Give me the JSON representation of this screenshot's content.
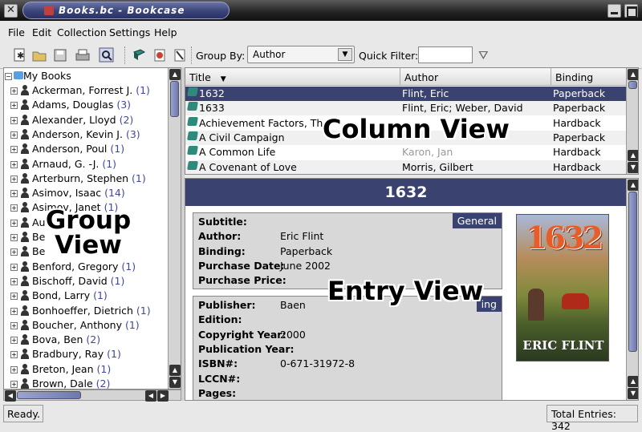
{
  "window": {
    "title": "Books.bc - Bookcase"
  },
  "menu": [
    "File",
    "Edit",
    "Collection",
    "Settings",
    "Help"
  ],
  "toolbar": {
    "group_by_label": "Group By:",
    "group_by_value": "Author",
    "quick_filter_label": "Quick Filter:",
    "quick_filter_value": ""
  },
  "group_view": {
    "root": "My Books",
    "items": [
      {
        "name": "Ackerman, Forrest J.",
        "count": "(1)"
      },
      {
        "name": "Adams, Douglas",
        "count": "(3)"
      },
      {
        "name": "Alexander, Lloyd",
        "count": "(2)"
      },
      {
        "name": "Anderson, Kevin J.",
        "count": "(3)"
      },
      {
        "name": "Anderson, Poul",
        "count": "(1)"
      },
      {
        "name": "Arnaud, G. -J.",
        "count": "(1)"
      },
      {
        "name": "Arterburn, Stephen",
        "count": "(1)"
      },
      {
        "name": "Asimov, Isaac",
        "count": "(14)"
      },
      {
        "name": "Asimov, Janet",
        "count": "(1)"
      },
      {
        "name": "Au",
        "count": ""
      },
      {
        "name": "Be",
        "count": ""
      },
      {
        "name": "Be",
        "count": ""
      },
      {
        "name": "Benford, Gregory",
        "count": "(1)"
      },
      {
        "name": "Bischoff, David",
        "count": "(1)"
      },
      {
        "name": "Bond, Larry",
        "count": "(1)"
      },
      {
        "name": "Bonhoeffer, Dietrich",
        "count": "(1)"
      },
      {
        "name": "Boucher, Anthony",
        "count": "(1)"
      },
      {
        "name": "Bova, Ben",
        "count": "(2)"
      },
      {
        "name": "Bradbury, Ray",
        "count": "(1)"
      },
      {
        "name": "Breton, Jean",
        "count": "(1)"
      },
      {
        "name": "Brown, Dale",
        "count": "(2)"
      }
    ]
  },
  "column_view": {
    "headers": [
      "Title",
      "Author",
      "Binding"
    ],
    "rows": [
      {
        "title": "1632",
        "author": "Flint, Eric",
        "binding": "Paperback"
      },
      {
        "title": "1633",
        "author": "Flint, Eric; Weber, David",
        "binding": "Paperback"
      },
      {
        "title": "Achievement Factors, The",
        "author": "",
        "binding": "Hardback"
      },
      {
        "title": "A Civil Campaign",
        "author": "",
        "binding": "Paperback"
      },
      {
        "title": "A Common Life",
        "author": "Karon, Jan",
        "binding": "Hardback"
      },
      {
        "title": "A Covenant of Love",
        "author": "Morris, Gilbert",
        "binding": "Hardback"
      }
    ]
  },
  "entry_view": {
    "title": "1632",
    "general_tag": "General",
    "publishing_tag": "ing",
    "general_fields": [
      {
        "label": "Subtitle:",
        "value": ""
      },
      {
        "label": "Author:",
        "value": "Eric Flint"
      },
      {
        "label": "Binding:",
        "value": "Paperback"
      },
      {
        "label": "Purchase Date:",
        "value": "June 2002"
      },
      {
        "label": "Purchase Price:",
        "value": ""
      }
    ],
    "publishing_fields": [
      {
        "label": "Publisher:",
        "value": "Baen"
      },
      {
        "label": "Edition:",
        "value": ""
      },
      {
        "label": "Copyright Year:",
        "value": "2000"
      },
      {
        "label": "Publication Year:",
        "value": ""
      },
      {
        "label": "ISBN#:",
        "value": "0-671-31972-8"
      },
      {
        "label": "LCCN#:",
        "value": ""
      },
      {
        "label": "Pages:",
        "value": ""
      }
    ],
    "cover_title": "1632",
    "cover_author": "ERIC FLINT"
  },
  "overlays": {
    "group": "Group\nView",
    "column": "Column View",
    "entry": "Entry View"
  },
  "status": {
    "left": "Ready.",
    "right": "Total Entries: 342"
  }
}
